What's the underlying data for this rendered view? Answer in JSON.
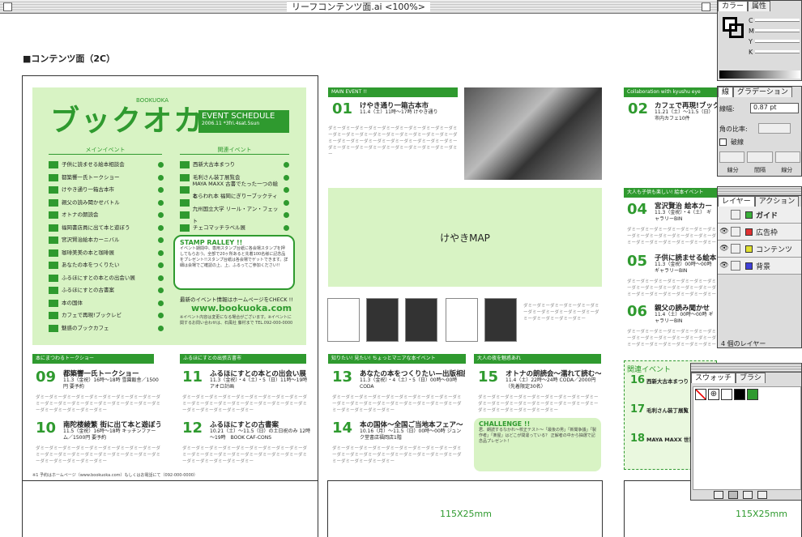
{
  "window": {
    "title": "リーフコンテンツ面.ai <100%>"
  },
  "doc_label": "■コンテンツ面（2C）",
  "left_panel": {
    "logo": "ブックオカ",
    "logo_small": "BOOKUOKA",
    "schedule_title": "EVENT SCHEDULE",
    "schedule_date": "2006.11 *3fri.4sat.5sun",
    "col1_head": "メインイベント",
    "col2_head": "関連イベント",
    "main_events": [
      "子供に読ませる絵本相談会",
      "都築響一氏トークショー",
      "けやき通り一箱古本市",
      "親父の読み聞かせバトル",
      "オトナの朗読会",
      "福岡書店員に出て本と遊ぼう",
      "宮沢賢治絵本カーニバル",
      "珈琲美美の本と珈琲展",
      "あなたの本をつくりたい",
      "ふるほにすとの本との出会い展",
      "ふるほにすとの古書案",
      "本の国体",
      "カフェで再現!ブックレビ",
      "魅惑のブックカフェ"
    ],
    "related_events": [
      "西新大古本まつり",
      "毛利さん装丁展覧会",
      "MAYA MAXX 古書でたった一つの絵本",
      "とらわれ本 福岡にぎりーブックティー",
      "九州国立大学 リール・アン・フェット",
      "チェコマッチラベル展"
    ],
    "stamp_title": "STAMP RALLEY !!",
    "stamp_text": "イベント期間中、専用スタンプ台紙に各会場スタンプを押してもらおう。全部で20ヶ所あると先着100名様に記念品をプレゼント!!スタンプ台紙は各会場でゲットできます。詳細は会場でご確認の上、上、ふるってご参加ください!!",
    "hp_text": "最新のイベント情報はホームページをCHECK !!",
    "url": "www.bookuoka.com",
    "notes": "※イベント内容は変更になる場合がございます。※イベントに関するお問い合わせは、石風社 藤村まで TEL.092-000-0000"
  },
  "bottom_left": {
    "head1": "本にまつわるトークショー",
    "head2": "ふるほにすとの出張古書市",
    "items": [
      {
        "num": "09",
        "title": "都築響一氏トークショー",
        "sub": "11.3（金祝）16時～18時 雪園飯舎／1500円 要予約"
      },
      {
        "num": "10",
        "title": "南陀楼綾繁 街に出て本と遊ぼう",
        "sub": "11.5（金祝）16時～18時 キッチンファーム／1500円 要予約"
      },
      {
        "num": "11",
        "title": "ふるほにすとの本との出会い展",
        "sub": "11.3（金祝）・4（土）・5（日）11時～19時 アオロ計画"
      },
      {
        "num": "12",
        "title": "ふるほにすとの古書案",
        "sub": "10.21（土）～11.5（日）の土日祝のみ 12時～19時　BOOK CAF-CONS"
      }
    ],
    "footnote": "※1 予約はホームページ（www.bookuoka.com）もしくはお電話にて（092-000-0000）"
  },
  "mid": {
    "main_event": "MAIN EVENT !!",
    "item01": {
      "num": "01",
      "title": "けやき通り一箱古本市",
      "sub": "11.4（土）11時～17時 けやき通り"
    },
    "map": "けやきMAP",
    "head3": "知りたい! 見たい! ちょっとマニアな本イベント",
    "head4": "大人の夜を魅惑あれ",
    "items": [
      {
        "num": "13",
        "title": "あなたの本をつくりたい—出版相談会—",
        "sub": "11.3（金祝）・4（土）・5（日）00時～00時 CODA"
      },
      {
        "num": "14",
        "title": "本の国体～全国ご当地本フェア～",
        "sub": "10.16（月）～11.5（日）00時～00時 ジュンク堂書店福岡店1階"
      },
      {
        "num": "15",
        "title": "オトナの朗読会～濡れて読む～",
        "sub": "11.4（土）22時～24時 CODA／2000円（先着限定30名）"
      }
    ],
    "challenge_title": "CHALLENGE !!",
    "challenge_text": "君、朗読するなかれ～校正テスト～「最後の男」「新聞争議」「製作者」「楽屋」はどこが間違っている？ 正解者の中から抽選で記念品プレゼント！"
  },
  "right": {
    "collab": "Collaboration with kyushu eye",
    "item02": {
      "num": "02",
      "title": "カフェで再現!ブック",
      "sub": "11.21（土）～11.5（日） 市内カフェ10件"
    },
    "head5": "大人も子供も楽しい! 絵本イベント",
    "items": [
      {
        "num": "04",
        "title": "宮沢賢治 絵本カー",
        "sub": "11.3（金祝）・4（土） ギャラリーBIN"
      },
      {
        "num": "05",
        "title": "子供に読ませる絵本",
        "sub": "11.3（金祝）00時～00時 ギャラリーBIN"
      },
      {
        "num": "06",
        "title": "親父の読み聞かせ",
        "sub": "11.4（土）00時～00時 ギャラリーBIN"
      }
    ],
    "related_head": "関連イベント",
    "related": [
      {
        "num": "16",
        "title": "西新大古本まつり"
      },
      {
        "num": "17",
        "title": "毛利さん装丁展覧"
      },
      {
        "num": "18",
        "title": "MAYA MAXX 世界"
      }
    ]
  },
  "size_label_1": "115X25mm",
  "size_label_2": "115X25mm",
  "palettes": {
    "color": {
      "tabs": [
        "カラー",
        "属性"
      ],
      "channels": [
        "C",
        "M",
        "Y",
        "K"
      ]
    },
    "stroke": {
      "tabs": [
        "線",
        "グラデーション"
      ],
      "width_label": "線幅:",
      "width_value": "0.87 pt",
      "miter_label": "角の比率:",
      "dash_label": "破線",
      "caps": [
        "線分",
        "間隔",
        "線分"
      ]
    },
    "layers": {
      "tabs": [
        "レイヤー",
        "アクション"
      ],
      "rows": [
        {
          "name": "ガイド",
          "color": "#3ab03a"
        },
        {
          "name": "広告枠",
          "color": "#e03030"
        },
        {
          "name": "コンテンツ",
          "color": "#e0e030"
        },
        {
          "name": "背景",
          "color": "#4040d8"
        }
      ],
      "count": "4 個のレイヤー"
    },
    "swatches": {
      "tabs": [
        "スウォッチ",
        "ブラシ"
      ]
    }
  }
}
